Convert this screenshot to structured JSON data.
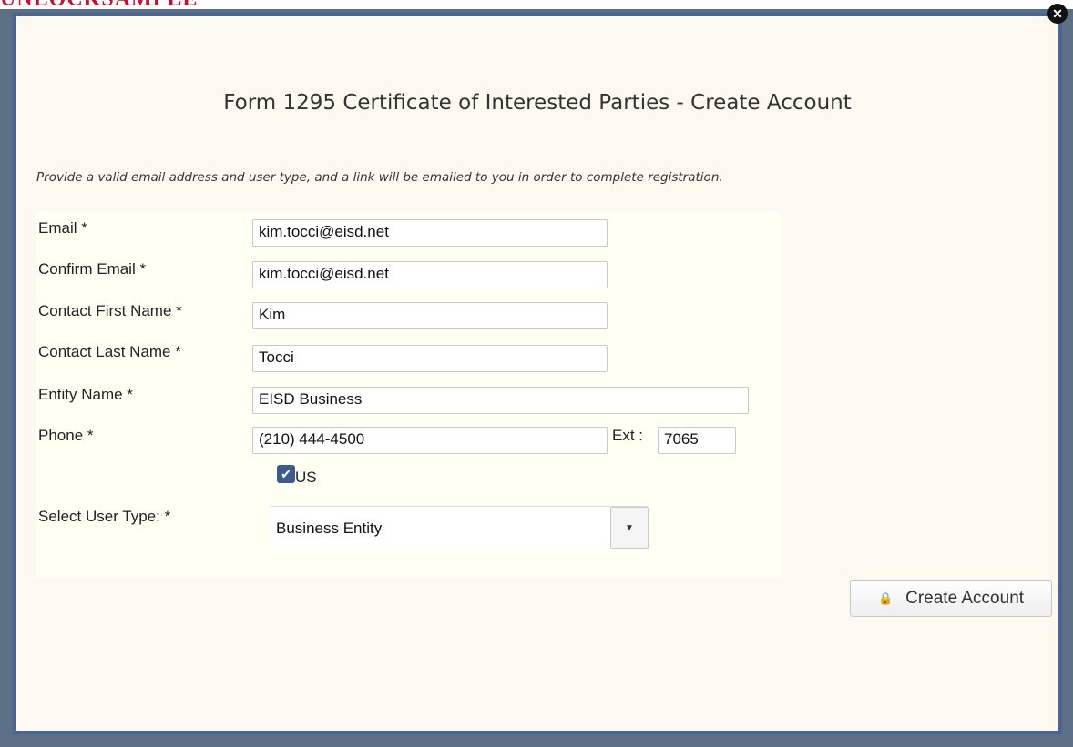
{
  "watermark": "UNLOCKSAMPLE",
  "dialog": {
    "title": "Form 1295 Certificate of Interested Parties - Create Account",
    "instructions": "Provide a valid email address and user type, and a link will be emailed to you in order to complete registration."
  },
  "form": {
    "email": {
      "label": "Email *",
      "value": "kim.tocci@eisd.net"
    },
    "confirm_email": {
      "label": "Confirm Email *",
      "value": "kim.tocci@eisd.net"
    },
    "first_name": {
      "label": "Contact First Name *",
      "value": "Kim"
    },
    "last_name": {
      "label": "Contact Last Name *",
      "value": "Tocci"
    },
    "entity_name": {
      "label": "Entity Name *",
      "value": "EISD Business"
    },
    "phone": {
      "label": "Phone *",
      "value": "(210) 444-4500",
      "ext_label": "Ext :",
      "ext_value": "7065"
    },
    "us_checkbox": {
      "label": "US",
      "checked": true
    },
    "user_type": {
      "label": "Select User Type: *",
      "value": "Business Entity"
    }
  },
  "buttons": {
    "create_account": "Create Account"
  },
  "icons": {
    "lock": "lock-icon",
    "close": "close-icon",
    "dropdown": "chevron-down-icon",
    "check": "check-icon"
  },
  "colors": {
    "modal_border": "#4a6491",
    "modal_bg": "#fdf9f0",
    "checkbox": "#3d5a8a",
    "watermark": "#c8102e"
  }
}
